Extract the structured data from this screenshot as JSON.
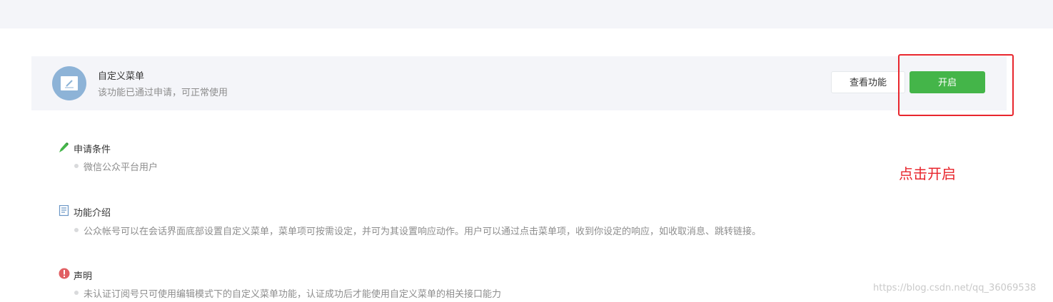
{
  "feature": {
    "title": "自定义菜单",
    "description": "该功能已通过申请，可正常使用",
    "icon": "edit-document-icon",
    "view_button": "查看功能",
    "enable_button": "开启"
  },
  "annotation": {
    "text": "点击开启"
  },
  "sections": [
    {
      "icon": "pen-icon",
      "title": "申请条件",
      "text": "微信公众平台用户"
    },
    {
      "icon": "document-icon",
      "title": "功能介绍",
      "text": "公众帐号可以在会话界面底部设置自定义菜单，菜单项可按需设定，并可为其设置响应动作。用户可以通过点击菜单项，收到你设定的响应，如收取消息、跳转链接。"
    },
    {
      "icon": "exclamation-icon",
      "title": "声明",
      "text": "未认证订阅号只可使用编辑模式下的自定义菜单功能，认证成功后才能使用自定义菜单的相关接口能力"
    }
  ],
  "watermark": "https://blog.csdn.net/qq_36069538",
  "colors": {
    "accent_green": "#44b549",
    "annotation_red": "#e8262d",
    "card_background": "#f4f5f9",
    "avatar_blue": "#8db3d7",
    "warning_red": "#e15f63",
    "doc_blue": "#6b97c6"
  }
}
